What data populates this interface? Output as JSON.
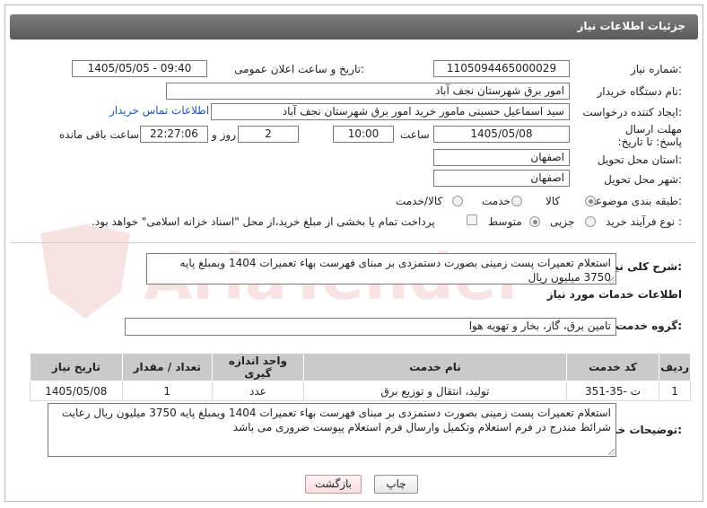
{
  "header": {
    "title": "جزئیات اطلاعات نیاز"
  },
  "fields": {
    "need_number_label": "شماره نیاز:",
    "need_number": "1105094465000029",
    "announce_label": "تاریخ و ساعت اعلان عمومی:",
    "announce_value": "1405/05/05 - 09:40",
    "buyer_org_label": "نام دستگاه خریدار:",
    "buyer_org": "امور برق شهرستان نجف آباد",
    "requester_label": "ایجاد کننده درخواست:",
    "requester": "سید اسماعیل  حسینی  مامور خرید  امور برق شهرستان نجف آباد",
    "contact_link": "اطلاعات تماس خریدار",
    "deadline_label": "مهلت ارسال پاسخ: تا تاریخ:",
    "deadline_date": "1405/05/08",
    "time_label": "ساعت",
    "deadline_time": "10:00",
    "days_value": "2",
    "days_label": "روز و",
    "remaining_time": "22:27:06",
    "remaining_label": "ساعت باقی مانده",
    "province_label": "استان محل تحویل:",
    "province": "اصفهان",
    "city_label": "شهر محل تحویل:",
    "city": "اصفهان",
    "category_label": "طبقه بندی موضوعی:",
    "category_options": {
      "goods": "کالا",
      "service": "خدمت",
      "goods_service": "کالا/خدمت"
    },
    "process_label": "نوع فرآیند خرید :",
    "process_options": {
      "minor": "جزیی",
      "medium": "متوسط"
    },
    "payment_note": "پرداخت تمام یا بخشی از مبلغ خرید،از محل \"اسناد خزانه اسلامی\" خواهد بود."
  },
  "summary": {
    "label": "شرح کلی نیاز:",
    "text": "استعلام تعمیرات پست زمینی  بصورت دستمزدی بر مبنای فهرست بهاء تعمیرات  1404 وبمبلغ پایه 3750 میلیون ریال"
  },
  "services_info_title": "اطلاعات خدمات مورد نیاز",
  "service_group": {
    "label": "گروه خدمت:",
    "value": "تامین برق، گاز، بخار و تهویه هوا"
  },
  "table": {
    "headers": {
      "row": "ردیف",
      "code": "کد خدمت",
      "name": "نام خدمت",
      "unit": "واحد اندازه گیری",
      "qty": "تعداد / مقدار",
      "date": "تاریخ نیاز"
    },
    "rows": [
      {
        "row": "1",
        "code": "ت -35-351",
        "name": "تولید، انتقال و توزیع برق",
        "unit": "عدد",
        "qty": "1",
        "date": "1405/05/08"
      }
    ]
  },
  "buyer_notes": {
    "label": "توضیحات خریدار:",
    "text": "استعلام تعمیرات پست زمینی  بصورت دستمزدی بر مبنای فهرست بهاء تعمیرات  1404 وبمبلغ پایه 3750 میلیون ریال رعایت شرائط مندرج در فرم استعلام وتکمیل وارسال فرم استعلام پیوست ضروری می باشد"
  },
  "buttons": {
    "print": "چاپ",
    "back": "بازگشت"
  },
  "watermark": "AriaTender.net",
  "colors": {
    "header_bg": "#6b6b6b",
    "link": "#1a56c6",
    "table_header": "#c9c9c9",
    "back_button": "#f6dede"
  }
}
